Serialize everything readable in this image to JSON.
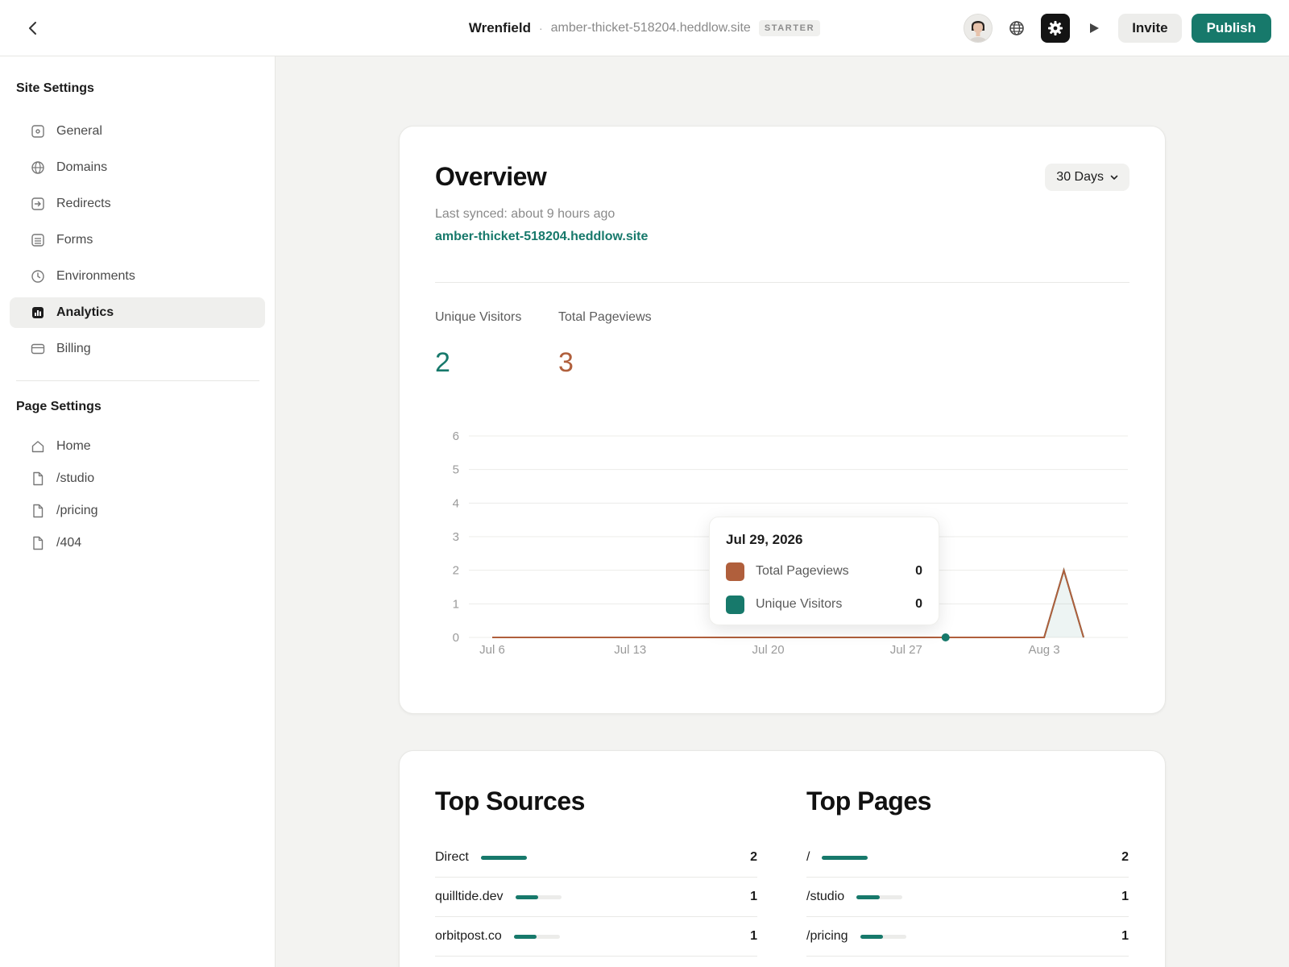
{
  "header": {
    "site_name": "Wrenfield",
    "separator": "·",
    "site_host": "amber-thicket-518204.heddlow.site",
    "plan_badge": "STARTER",
    "invite_label": "Invite",
    "publish_label": "Publish"
  },
  "sidebar": {
    "site_settings_heading": "Site Settings",
    "site_items": [
      {
        "label": "General",
        "icon": "square-dot-icon"
      },
      {
        "label": "Domains",
        "icon": "globe-icon"
      },
      {
        "label": "Redirects",
        "icon": "redirect-icon"
      },
      {
        "label": "Forms",
        "icon": "form-icon"
      },
      {
        "label": "Environments",
        "icon": "clock-icon"
      },
      {
        "label": "Analytics",
        "icon": "analytics-icon",
        "active": true
      },
      {
        "label": "Billing",
        "icon": "card-icon"
      }
    ],
    "page_settings_heading": "Page Settings",
    "page_items": [
      {
        "label": "Home",
        "icon": "home-icon"
      },
      {
        "label": "/studio",
        "icon": "page-icon"
      },
      {
        "label": "/pricing",
        "icon": "page-icon"
      },
      {
        "label": "/404",
        "icon": "page-icon"
      }
    ]
  },
  "overview": {
    "title": "Overview",
    "range_label": "30 Days",
    "last_synced": "Last synced: about 9 hours ago",
    "site_link": "amber-thicket-518204.heddlow.site",
    "metrics": {
      "unique_visitors_label": "Unique Visitors",
      "unique_visitors_value": "2",
      "total_pageviews_label": "Total Pageviews",
      "total_pageviews_value": "3"
    },
    "tooltip": {
      "date": "Jul 29, 2026",
      "pageviews_label": "Total Pageviews",
      "pageviews_value": "0",
      "visitors_label": "Unique Visitors",
      "visitors_value": "0"
    }
  },
  "chart_data": {
    "type": "area",
    "x": [
      "Jul 6",
      "Jul 7",
      "Jul 8",
      "Jul 9",
      "Jul 10",
      "Jul 11",
      "Jul 12",
      "Jul 13",
      "Jul 14",
      "Jul 15",
      "Jul 16",
      "Jul 17",
      "Jul 18",
      "Jul 19",
      "Jul 20",
      "Jul 21",
      "Jul 22",
      "Jul 23",
      "Jul 24",
      "Jul 25",
      "Jul 26",
      "Jul 27",
      "Jul 28",
      "Jul 29",
      "Jul 30",
      "Jul 31",
      "Aug 1",
      "Aug 2",
      "Aug 3",
      "Aug 4",
      "Aug 5"
    ],
    "x_tick_labels": [
      "Jul 6",
      "Jul 13",
      "Jul 20",
      "Jul 27",
      "Aug 3"
    ],
    "y_ticks": [
      0,
      1,
      2,
      3,
      4,
      5,
      6
    ],
    "ylim": [
      0,
      6
    ],
    "grid": true,
    "highlighted_x": "Jul 29",
    "series": [
      {
        "name": "Total Pageviews",
        "color": "#b05f3c",
        "values": [
          0,
          0,
          0,
          0,
          0,
          0,
          0,
          0,
          0,
          0,
          0,
          0,
          0,
          0,
          0,
          0,
          0,
          0,
          0,
          0,
          0,
          0,
          0,
          0,
          0,
          0,
          0,
          0,
          0,
          2,
          0
        ]
      },
      {
        "name": "Unique Visitors",
        "color": "#17796b",
        "values": [
          0,
          0,
          0,
          0,
          0,
          0,
          0,
          0,
          0,
          0,
          0,
          0,
          0,
          0,
          0,
          0,
          0,
          0,
          0,
          0,
          0,
          0,
          0,
          0,
          0,
          0,
          0,
          0,
          0,
          2,
          0
        ]
      }
    ]
  },
  "top_sources": {
    "title": "Top Sources",
    "rows": [
      {
        "label": "Direct",
        "count": "2",
        "share": 1.0
      },
      {
        "label": "quilltide.dev",
        "count": "1",
        "share": 0.5
      },
      {
        "label": "orbitpost.co",
        "count": "1",
        "share": 0.5
      }
    ]
  },
  "top_pages": {
    "title": "Top Pages",
    "rows": [
      {
        "label": "/",
        "count": "2",
        "share": 1.0
      },
      {
        "label": "/studio",
        "count": "1",
        "share": 0.5
      },
      {
        "label": "/pricing",
        "count": "1",
        "share": 0.5
      }
    ]
  },
  "colors": {
    "accent": "#17796b",
    "pageviews": "#b05f3c"
  }
}
